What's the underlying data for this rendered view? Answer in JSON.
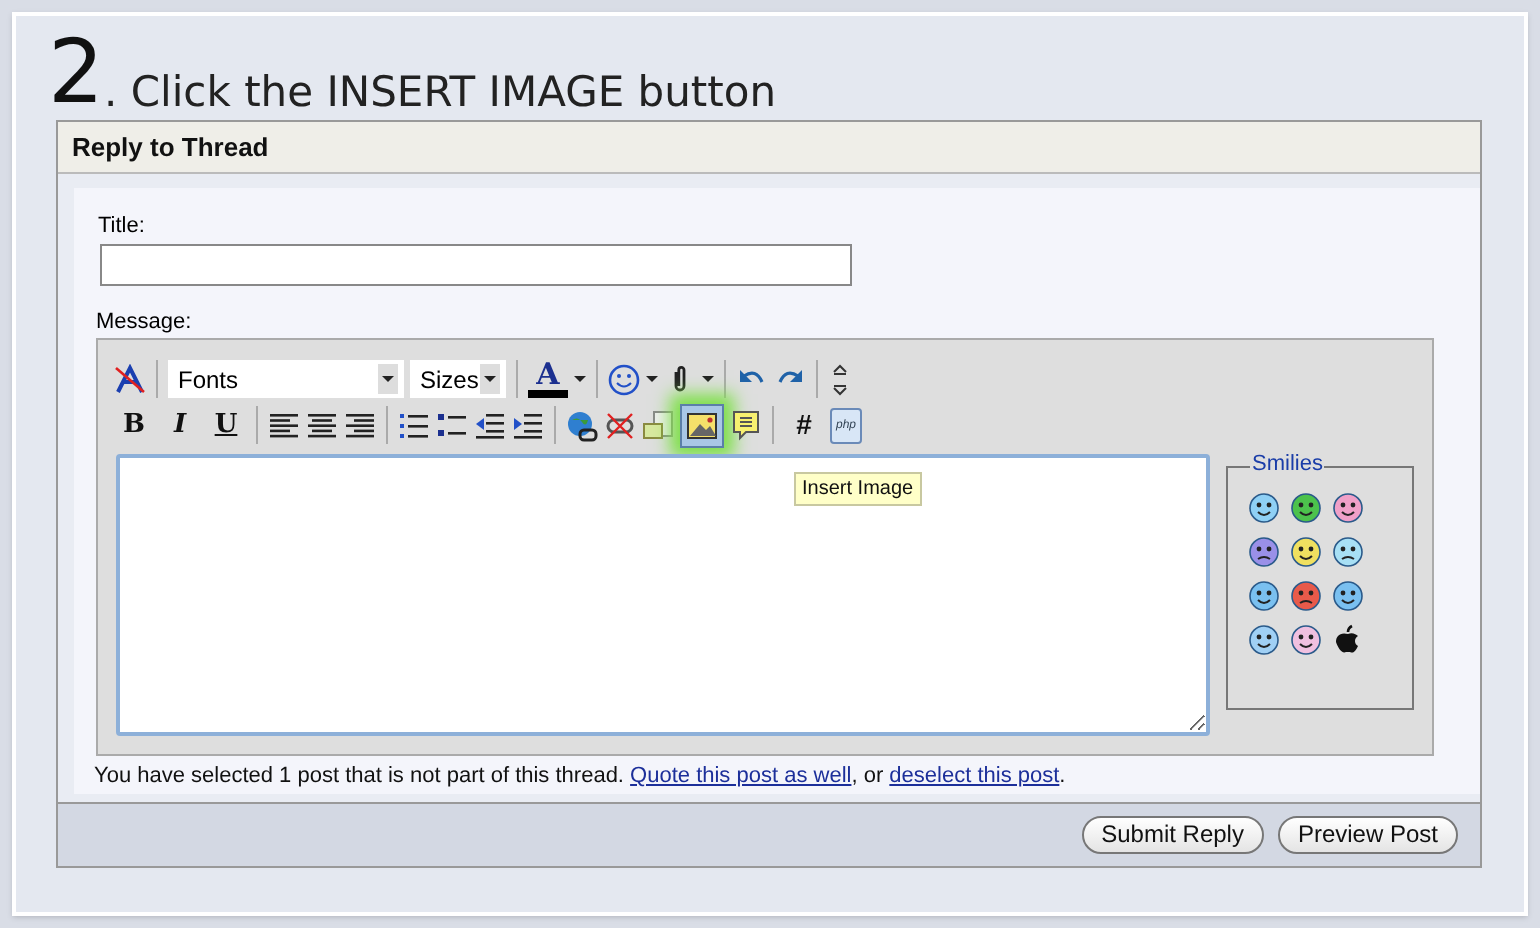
{
  "step": {
    "number": "2",
    "instruction": ". Click the INSERT IMAGE button"
  },
  "panel": {
    "title": "Reply to Thread"
  },
  "title_field": {
    "label": "Title:"
  },
  "message": {
    "label": "Message:"
  },
  "toolbar": {
    "font_select": "Fonts",
    "size_select": "Sizes",
    "font_color_label": "A",
    "bold": "B",
    "italic": "I",
    "underline": "U",
    "hash": "#",
    "php": "php",
    "insert_image": {
      "highlighted": true,
      "tooltip": "Insert Image"
    }
  },
  "smilies": {
    "legend": "Smilies"
  },
  "notice": [
    {
      "kind": "text",
      "text": "You have selected 1 post that is not part of this thread. "
    },
    {
      "kind": "link",
      "text": "Quote this post as well"
    },
    {
      "kind": "text",
      "text": ", or "
    },
    {
      "kind": "link",
      "text": "deselect this post"
    },
    {
      "kind": "text",
      "text": "."
    }
  ],
  "buttons": [
    "Submit Reply",
    "Preview Post"
  ]
}
